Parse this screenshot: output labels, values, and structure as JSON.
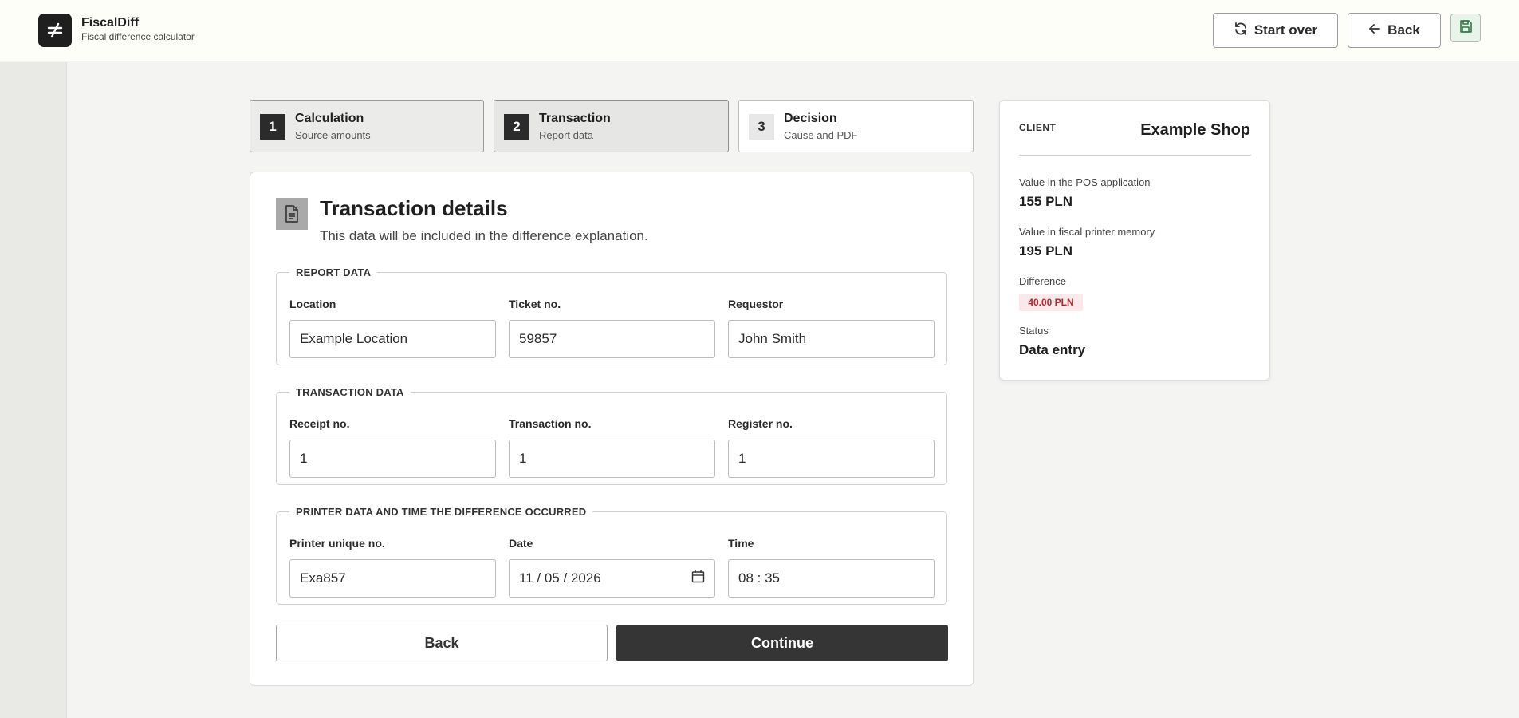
{
  "header": {
    "logo_icon": "not-equal-icon",
    "app_name": "FiscalDiff",
    "app_subtitle": "Fiscal difference calculator",
    "start_over_label": "Start over",
    "back_label": "Back",
    "save_icon": "save-icon"
  },
  "steps": [
    {
      "num": "1",
      "title": "Calculation",
      "sub": "Source amounts"
    },
    {
      "num": "2",
      "title": "Transaction",
      "sub": "Report data"
    },
    {
      "num": "3",
      "title": "Decision",
      "sub": "Cause and PDF"
    }
  ],
  "card": {
    "icon": "document-icon",
    "title": "Transaction details",
    "subtitle": "This data will be included in the difference explanation.",
    "report": {
      "legend": "REPORT DATA",
      "location_label": "Location",
      "location_value": "Example Location",
      "ticket_label": "Ticket no.",
      "ticket_value": "59857",
      "requestor_label": "Requestor",
      "requestor_value": "John Smith"
    },
    "transaction": {
      "legend": "TRANSACTION DATA",
      "receipt_label": "Receipt no.",
      "receipt_value": "1",
      "transaction_label": "Transaction no.",
      "transaction_value": "1",
      "register_label": "Register no.",
      "register_value": "1"
    },
    "printer": {
      "legend": "PRINTER DATA AND TIME THE DIFFERENCE OCCURRED",
      "printer_label": "Printer unique no.",
      "printer_value": "Exa857",
      "date_label": "Date",
      "date_value": "11 / 05 / 2026",
      "time_label": "Time",
      "time_value": "08 : 35"
    },
    "back_label": "Back",
    "continue_label": "Continue"
  },
  "client": {
    "label": "CLIENT",
    "name": "Example Shop",
    "pos_label": "Value in the POS application",
    "pos_value": "155 PLN",
    "printer_label": "Value in fiscal printer memory",
    "printer_value": "195 PLN",
    "difference_label": "Difference",
    "difference_value": "40.00 PLN",
    "status_label": "Status",
    "status_value": "Data entry"
  },
  "colors": {
    "accent_dark": "#353535",
    "difference_text": "#b8252f",
    "difference_bg": "#fbe9ea",
    "save_bg": "#e8f3ea"
  }
}
